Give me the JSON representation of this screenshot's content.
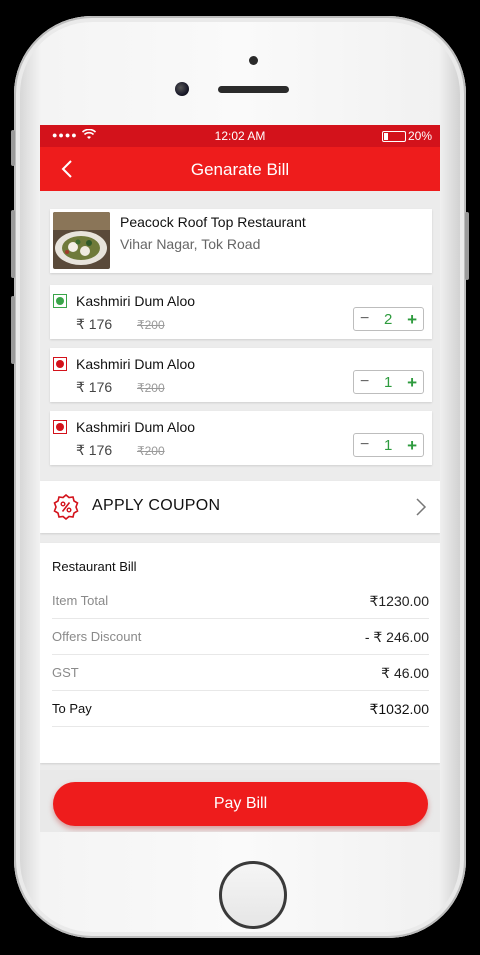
{
  "status_bar": {
    "time": "12:02 AM",
    "battery": "20%",
    "battery_level": 0.2
  },
  "header": {
    "title": "Genarate Bill",
    "back_icon": "chevron-left-icon"
  },
  "restaurant": {
    "name": "Peacock Roof Top Restaurant",
    "address": "Vihar Nagar, Tok Road"
  },
  "items": [
    {
      "name": "Kashmiri Dum Aloo",
      "price": "₹ 176",
      "old_price": "₹200",
      "qty": "2",
      "diet": "veg",
      "diet_color": "#3aa54a"
    },
    {
      "name": "Kashmiri Dum Aloo",
      "price": "₹ 176",
      "old_price": "₹200",
      "qty": "1",
      "diet": "non-veg",
      "diet_color": "#d3121b"
    },
    {
      "name": "Kashmiri Dum Aloo",
      "price": "₹ 176",
      "old_price": "₹200",
      "qty": "1",
      "diet": "non-veg",
      "diet_color": "#d3121b"
    }
  ],
  "stepper": {
    "minus": "−",
    "plus": "+"
  },
  "coupon": {
    "label": "APPLY COUPON"
  },
  "bill": {
    "heading": "Restaurant Bill",
    "rows": [
      {
        "label": "Item Total",
        "value": "₹1230.00"
      },
      {
        "label": "Offers Discount",
        "value": "- ₹ 246.00"
      },
      {
        "label": "GST",
        "value": "₹ 46.00"
      },
      {
        "label": "To Pay",
        "value": "₹1032.00"
      }
    ]
  },
  "pay_button": {
    "label": "Pay Bill"
  },
  "colors": {
    "brand_red": "#ee1c1c",
    "status_red": "#d3121b",
    "veg_green": "#3aa54a",
    "stepper_green": "#2e9b3e"
  }
}
